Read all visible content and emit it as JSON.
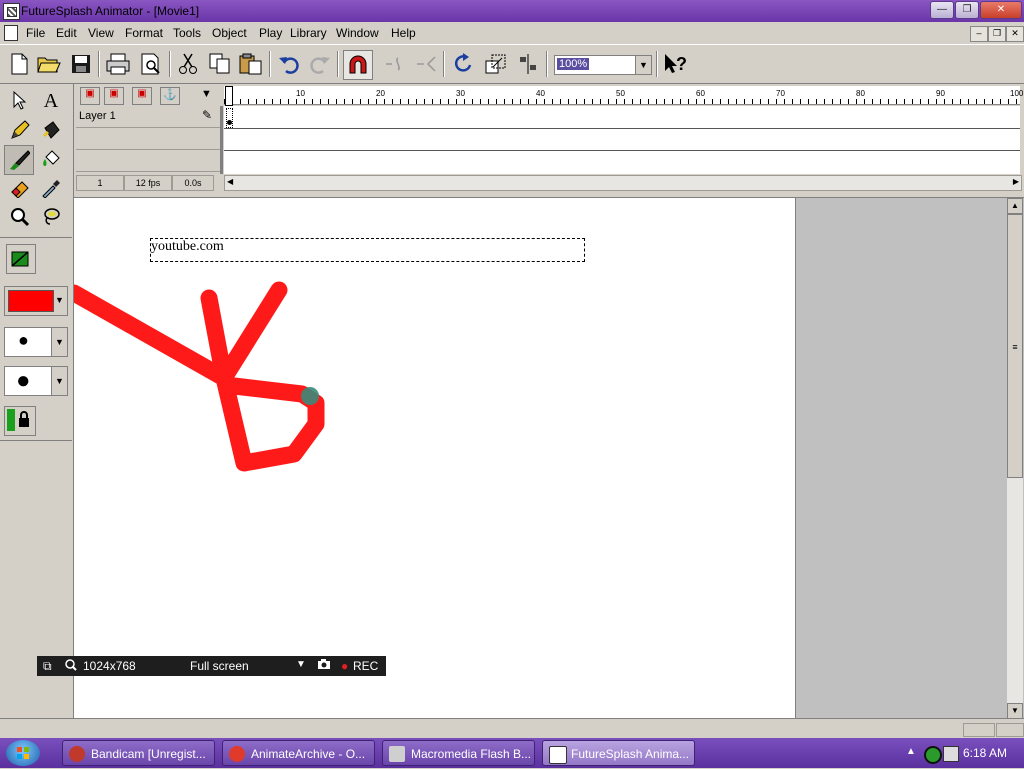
{
  "window": {
    "title": "FutureSplash Animator - [Movie1]",
    "minimize": "—",
    "maximize": "❐",
    "close": "✕"
  },
  "menu": [
    "File",
    "Edit",
    "View",
    "Format",
    "Tools",
    "Object",
    "Play",
    "Library",
    "Window",
    "Help"
  ],
  "mdi": {
    "min": "–",
    "restore": "❐",
    "close": "✕"
  },
  "toolbar": {
    "zoom_value": "100%",
    "icons": [
      "new-icon",
      "open-icon",
      "save-icon",
      "print-icon",
      "print-preview-icon",
      "cut-icon",
      "copy-icon",
      "paste-icon",
      "undo-icon",
      "redo-icon",
      "snap-magnet-icon",
      "smooth-icon",
      "straighten-icon",
      "rotate-icon",
      "scale-icon",
      "align-icon",
      "help-pointer-icon"
    ]
  },
  "tools": {
    "icons": [
      "arrow-tool-icon",
      "text-tool-icon",
      "pencil-tool-icon",
      "ink-bottle-tool-icon",
      "brush-tool-icon",
      "paint-bucket-tool-icon",
      "eraser-tool-icon",
      "dropper-tool-icon",
      "zoom-tool-icon",
      "lasso-tool-icon"
    ],
    "fill_color": "#ff0000",
    "brush_size_small": "●",
    "brush_size_large": "●"
  },
  "timeline": {
    "layer_name": "Layer 1",
    "ruler_labels": [
      "10",
      "20",
      "30",
      "40",
      "50",
      "60",
      "70",
      "80",
      "90",
      "100"
    ],
    "current_frame": "1",
    "frame_rate": "12 fps",
    "elapsed_time": "0.0s"
  },
  "stage": {
    "text": "youtube.com",
    "stroke_color": "#ff1a1a"
  },
  "recorder": {
    "resolution": "1024x768",
    "mode": "Full screen",
    "rec_label": "REC"
  },
  "taskbar": {
    "tasks": [
      {
        "label": "Bandicam [Unregist...",
        "icon_color": "#c0392b"
      },
      {
        "label": "AnimateArchive - O...",
        "icon_color": "#e03a2a"
      },
      {
        "label": "Macromedia Flash B...",
        "icon_color": "#cfcfcf"
      },
      {
        "label": "FutureSplash Anima...",
        "icon_color": "#ffffff"
      }
    ],
    "clock": "6:18 AM"
  }
}
